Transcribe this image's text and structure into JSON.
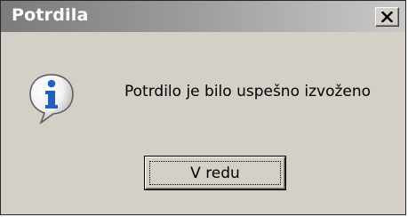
{
  "dialog": {
    "title": "Potrdila",
    "message": "Potrdilo je bilo uspešno izvoženo",
    "ok_label": "V redu",
    "close_label": "X",
    "icon": "info-icon"
  },
  "colors": {
    "window_bg": "#d4d0c8",
    "title_text": "#ffffff",
    "icon_blue": "#1f5fbf"
  }
}
